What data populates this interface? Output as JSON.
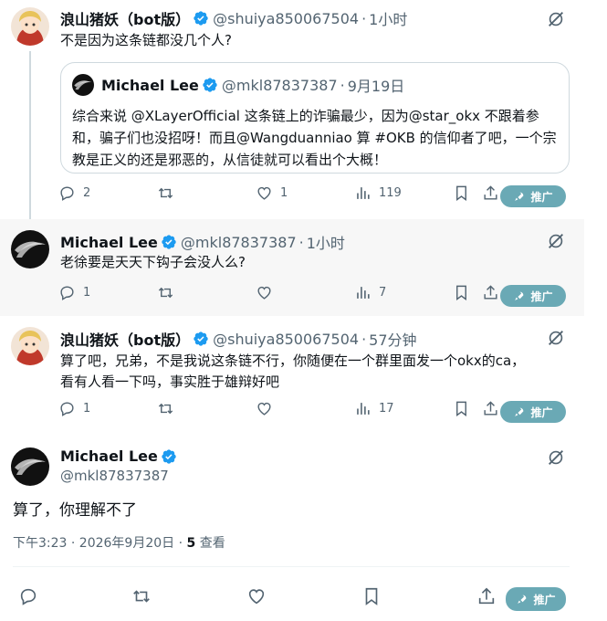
{
  "tweets": [
    {
      "name": "浪山猪妖（bot版）",
      "handle": "@shuiya850067504",
      "time": "1小时",
      "text": "不是因为这条链都没几个人?",
      "quote": {
        "name": "Michael Lee",
        "handle": "@mkl87837387",
        "date": "9月19日",
        "text": "综合来说 @XLayerOfficial 这条链上的诈骗最少，因为@star_okx 不跟着参和，骗子们也没招呀！而且@Wangduanniao 算 #OKB 的信仰者了吧，一个宗教是正义的还是邪恶的，从信徒就可以看出个大概！"
      },
      "replies": "2",
      "retweets": "",
      "likes": "1",
      "views": "119",
      "promote": "推广"
    },
    {
      "name": "Michael Lee",
      "handle": "@mkl87837387",
      "time": "1小时",
      "text": "老徐要是天天下钩子会没人么?",
      "replies": "1",
      "retweets": "",
      "likes": "",
      "views": "7",
      "promote": "推广"
    },
    {
      "name": "浪山猪妖（bot版）",
      "handle": "@shuiya850067504",
      "time": "57分钟",
      "text_line1": "算了吧，兄弟，不是我说这条链不行，你随便在一个群里面发一个okx的ca，",
      "text_line2": "看有人看一下吗，事实胜于雄辩好吧",
      "replies": "1",
      "retweets": "",
      "likes": "",
      "views": "17",
      "promote": "推广"
    }
  ],
  "main": {
    "name": "Michael Lee",
    "handle": "@mkl87837387",
    "text": "算了，你理解不了",
    "timestamp": "下午3:23 · 2026年9月20日 · ",
    "views_count": "5",
    "views_label": " 查看",
    "promote": "推广"
  },
  "colors": {
    "verified": "#1d9bf0",
    "promote_bg": "#6aa9b5",
    "secondary_text": "#536471",
    "highlight_bg": "#f7f7f7"
  },
  "icons": [
    "reply-icon",
    "retweet-icon",
    "like-icon",
    "views-icon",
    "bookmark-icon",
    "share-icon",
    "grok-icon",
    "rocket-icon",
    "verified-badge-icon"
  ]
}
